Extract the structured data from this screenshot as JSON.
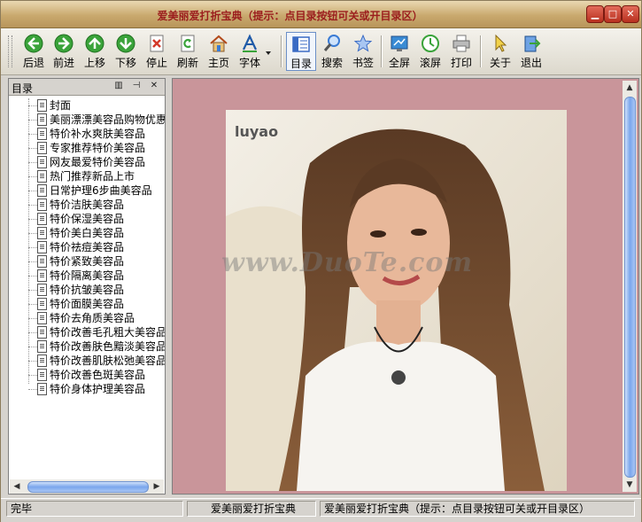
{
  "window": {
    "title": "爱美丽爱打折宝典（提示：点目录按钮可关或开目录区）",
    "controls": [
      "minimize",
      "maximize",
      "close"
    ]
  },
  "toolbar": {
    "buttons": [
      {
        "label": "后退",
        "icon": "back-arrow-icon",
        "color": "#3aa33a"
      },
      {
        "label": "前进",
        "icon": "forward-arrow-icon",
        "color": "#3aa33a"
      },
      {
        "label": "上移",
        "icon": "up-arrow-icon",
        "color": "#3aa33a"
      },
      {
        "label": "下移",
        "icon": "down-arrow-icon",
        "color": "#3aa33a"
      },
      {
        "label": "停止",
        "icon": "stop-icon",
        "color": "#d43a2a"
      },
      {
        "label": "刷新",
        "icon": "refresh-icon",
        "color": "#3aa33a"
      },
      {
        "label": "主页",
        "icon": "home-icon",
        "color": "#e8a33a"
      },
      {
        "label": "字体",
        "icon": "font-icon",
        "color": "#3a7bd4"
      },
      {
        "label": "目录",
        "icon": "contents-icon",
        "color": "#3a6bc4"
      },
      {
        "label": "搜索",
        "icon": "search-icon",
        "color": "#3a7bd4"
      },
      {
        "label": "书签",
        "icon": "bookmark-star-icon",
        "color": "#6a9be4"
      },
      {
        "label": "全屏",
        "icon": "fullscreen-icon",
        "color": "#3a8bd4"
      },
      {
        "label": "滚屏",
        "icon": "autoscroll-icon",
        "color": "#3aa33a"
      },
      {
        "label": "打印",
        "icon": "print-icon",
        "color": "#888888"
      },
      {
        "label": "关于",
        "icon": "about-cursor-icon",
        "color": "#e8c23a"
      },
      {
        "label": "退出",
        "icon": "exit-icon",
        "color": "#3a7bd4"
      }
    ]
  },
  "sidebar": {
    "title": "目录",
    "items": [
      "封面",
      "美丽漂漂美容品购物优惠",
      "特价补水爽肤美容品",
      "专家推荐特价美容品",
      "网友最爱特价美容品",
      "热门推荐新品上市",
      "日常护理6步曲美容品",
      "特价洁肤美容品",
      "特价保湿美容品",
      "特价美白美容品",
      "特价祛痘美容品",
      "特价紧致美容品",
      "特价隔离美容品",
      "特价抗皱美容品",
      "特价面膜美容品",
      "特价去角质美容品",
      "特价改善毛孔粗大美容品",
      "特价改善肤色黯淡美容品",
      "特价改善肌肤松弛美容品",
      "特价改善色斑美容品",
      "特价身体护理美容品"
    ]
  },
  "content": {
    "background": "#c9959a",
    "photo_logo": "luyao",
    "watermark": "www.DuoTe.com"
  },
  "status": {
    "left": "完毕",
    "middle": "爱美丽爱打折宝典",
    "right": "爱美丽爱打折宝典（提示：点目录按钮可关或开目录区）"
  }
}
